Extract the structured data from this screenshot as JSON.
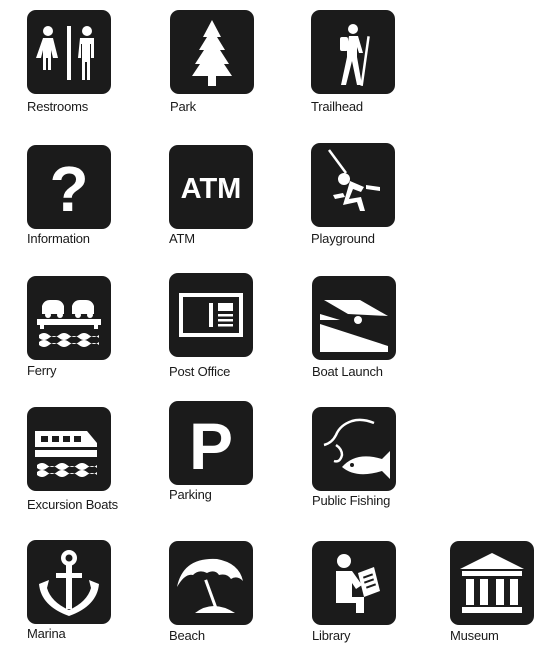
{
  "icons": {
    "restrooms": "Restrooms",
    "park": "Park",
    "trailhead": "Trailhead",
    "information": "Information",
    "atm": "ATM",
    "playground": "Playground",
    "ferry": "Ferry",
    "post_office": "Post Office",
    "boat_launch": "Boat Launch",
    "excursion_boats": "Excursion Boats",
    "parking": "Parking",
    "public_fishing": "Public Fishing",
    "marina": "Marina",
    "beach": "Beach",
    "library": "Library",
    "museum": "Museum"
  },
  "glyphs": {
    "question": "?",
    "atm": "ATM",
    "parking": "P"
  },
  "colors": {
    "icon_background": "#1b1b1b",
    "icon_foreground": "#ffffff",
    "label_text": "#1a1a1a"
  }
}
